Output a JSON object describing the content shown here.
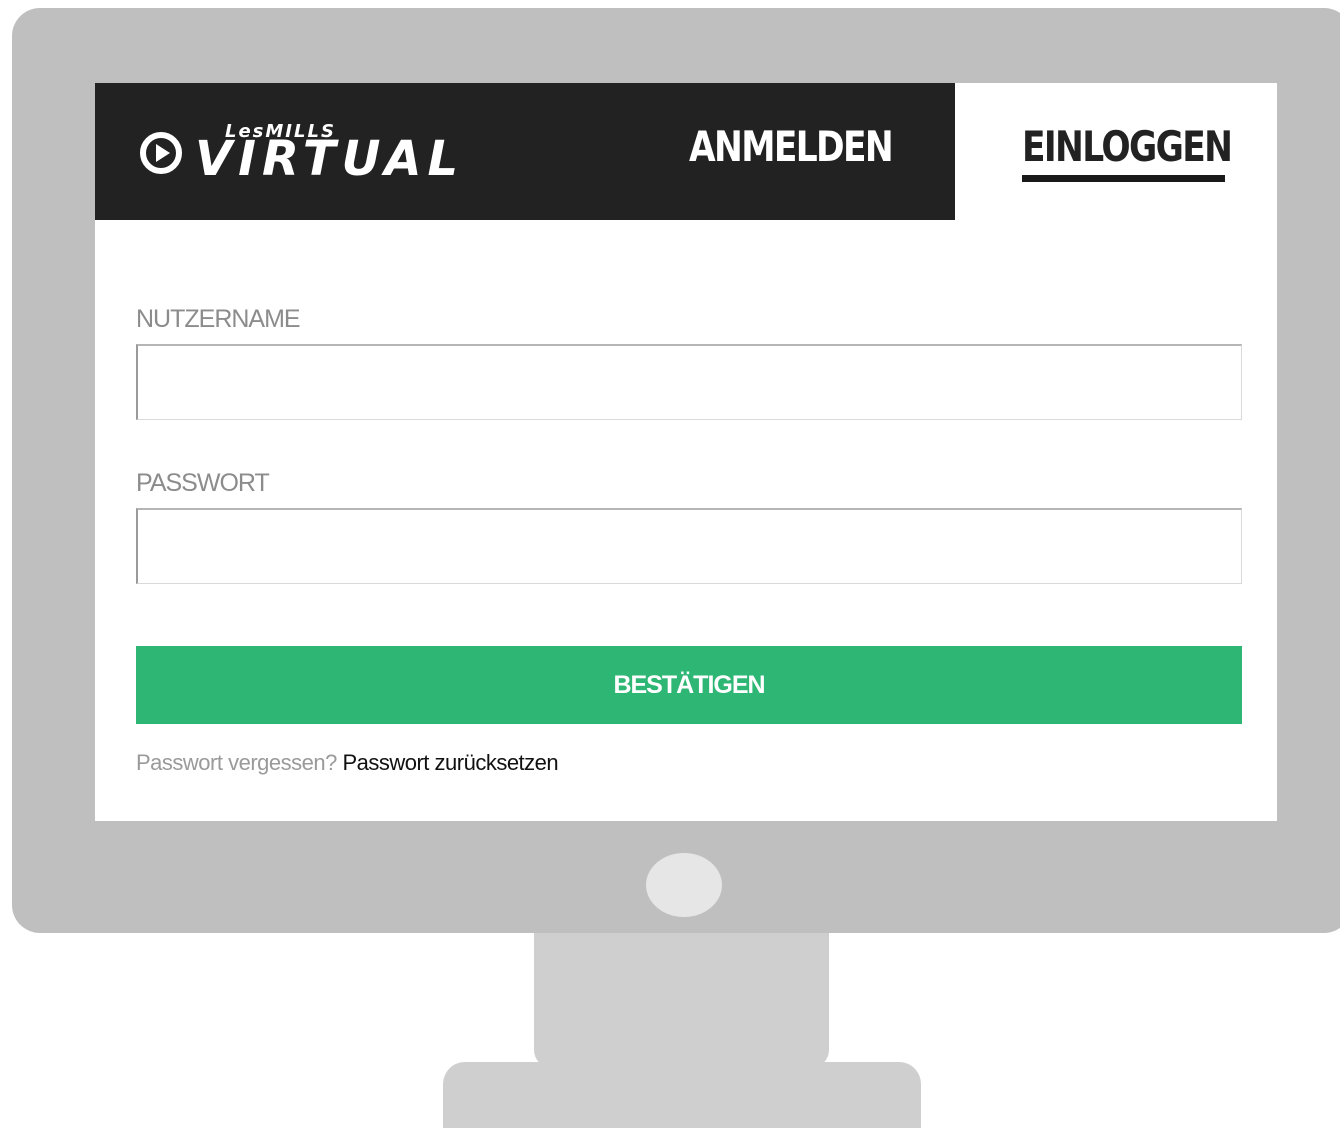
{
  "header": {
    "logo": {
      "brand_small": "LesMILLS",
      "brand_big": "VIRTUAL"
    },
    "tabs": [
      {
        "label": "ANMELDEN",
        "active": false
      },
      {
        "label": "EINLOGGEN",
        "active": true
      }
    ]
  },
  "form": {
    "username": {
      "label": "NUTZERNAME",
      "value": "",
      "placeholder": ""
    },
    "password": {
      "label": "PASSWORT",
      "value": "",
      "placeholder": ""
    },
    "submit_label": "BESTÄTIGEN",
    "forgot_text": "Passwort vergessen?",
    "reset_link": "Passwort zurücksetzen"
  },
  "colors": {
    "header_bg": "#222222",
    "accent_green": "#2db674",
    "monitor_frame": "#bfbfbf"
  }
}
